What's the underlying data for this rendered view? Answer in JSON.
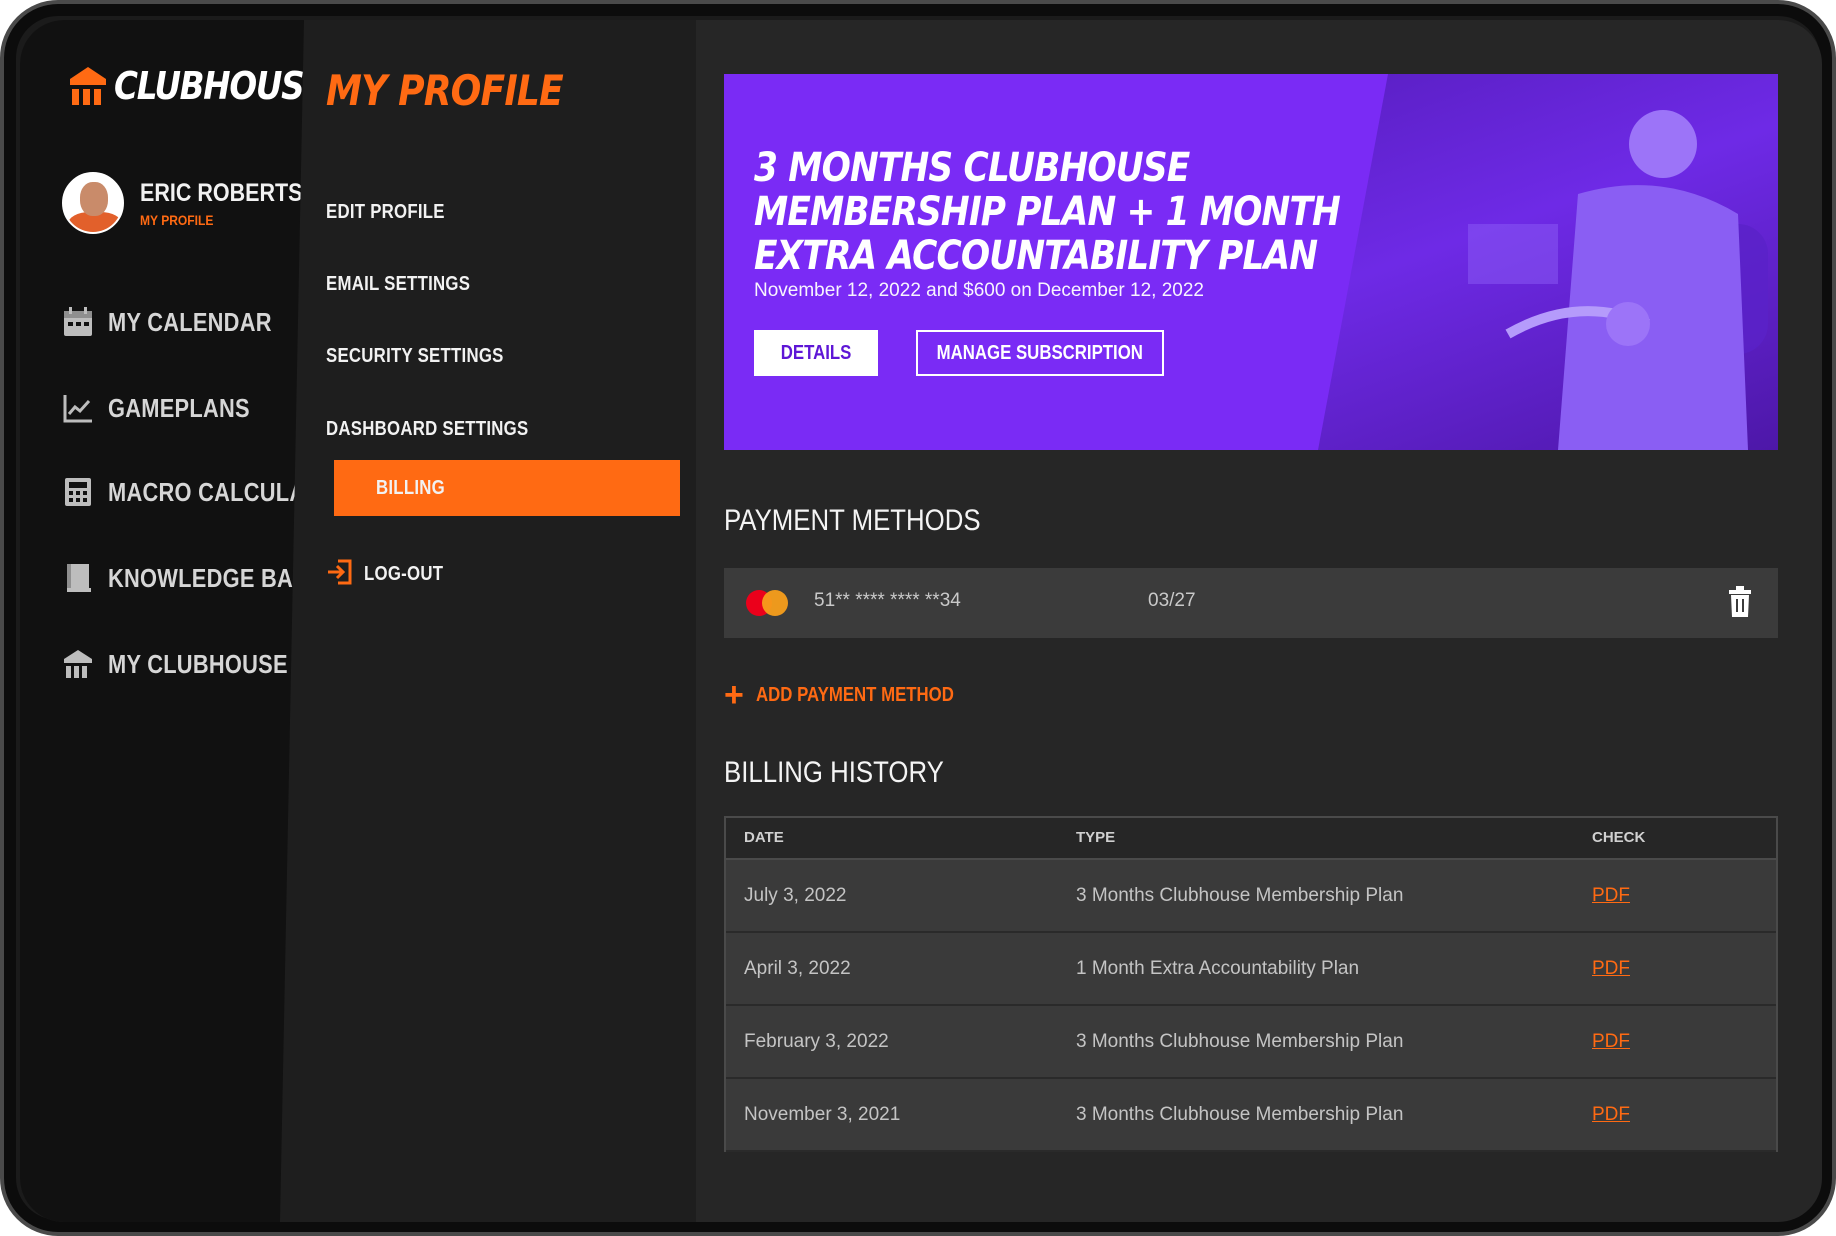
{
  "brand": {
    "name": "CLUBHOUSE",
    "accent": "#ff6a13",
    "hero_color": "#7a2bf5"
  },
  "user": {
    "name": "ERIC ROBERTS",
    "sub": "MY PROFILE"
  },
  "nav": {
    "items": [
      {
        "label": "MY CALENDAR",
        "icon": "calendar-icon"
      },
      {
        "label": "GAMEPLANS",
        "icon": "chart-icon"
      },
      {
        "label": "MACRO CALCULATOR",
        "icon": "calculator-icon"
      },
      {
        "label": "KNOWLEDGE BASE",
        "icon": "book-icon"
      },
      {
        "label": "MY CLUBHOUSE",
        "icon": "clubhouse-icon"
      }
    ]
  },
  "profile_menu": {
    "title": "MY PROFILE",
    "items": [
      {
        "label": "EDIT PROFILE"
      },
      {
        "label": "EMAIL SETTINGS"
      },
      {
        "label": "SECURITY SETTINGS"
      },
      {
        "label": "DASHBOARD SETTINGS"
      },
      {
        "label": "BILLING",
        "active": true
      },
      {
        "label": "LOG-OUT",
        "icon": "logout-icon"
      }
    ]
  },
  "hero": {
    "title": "3 MONTHS CLUBHOUSE MEMBERSHIP PLAN + 1 MONTH EXTRA ACCOUNTABILITY PLAN",
    "description": "November 12, 2022 and $600 on December 12, 2022",
    "details_label": "DETAILS",
    "manage_label": "MANAGE SUBSCRIPTION"
  },
  "payment": {
    "title": "PAYMENT METHODS",
    "card_number": "51** **** **** **34",
    "card_expiry": "03/27",
    "add_label": "ADD PAYMENT METHOD"
  },
  "billing": {
    "title": "BILLING HISTORY",
    "columns": [
      "DATE",
      "TYPE",
      "CHECK"
    ],
    "rows": [
      {
        "date": "July 3, 2022",
        "type": "3 Months Clubhouse Membership Plan",
        "check": "PDF"
      },
      {
        "date": "April 3, 2022",
        "type": "1 Month Extra Accountability Plan",
        "check": "PDF"
      },
      {
        "date": "February 3, 2022",
        "type": "3 Months Clubhouse Membership Plan",
        "check": "PDF"
      },
      {
        "date": "November 3, 2021",
        "type": "3 Months Clubhouse Membership Plan",
        "check": "PDF"
      }
    ]
  }
}
